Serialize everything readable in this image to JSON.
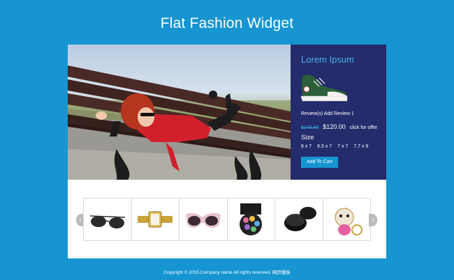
{
  "page": {
    "title": "Flat Fashion Widget"
  },
  "product": {
    "title": "Lorem Ipsum",
    "reviews_text": "Review(s)",
    "add_review_text": "Add Review 1",
    "old_price": "$140.00",
    "new_price": "$120.00",
    "offer_text": "click for offer",
    "size_label": "Size",
    "sizes": [
      "6 x 7",
      "6.5 x 7",
      "7 x 7",
      "7.7 x 9"
    ],
    "add_to_cart": "Add To Cart",
    "shoe_image": "sneaker-image"
  },
  "carousel": {
    "prev_icon": "chevron-left-icon",
    "next_icon": "chevron-right-icon",
    "prev_glyph": "‹",
    "next_glyph": "›",
    "items": [
      {
        "name": "sunglasses-image"
      },
      {
        "name": "gold-watch-image"
      },
      {
        "name": "fashion-sunglasses-image"
      },
      {
        "name": "makeup-palette-image"
      },
      {
        "name": "eyeliner-jar-image"
      },
      {
        "name": "dog-keychain-image"
      }
    ]
  },
  "footer": {
    "text": "Copyright © 2015.Company name All rights reserved.",
    "link": "网页模板"
  },
  "colors": {
    "background": "#1695d1",
    "panel": "#242c6c",
    "accent": "#43b2ea"
  }
}
